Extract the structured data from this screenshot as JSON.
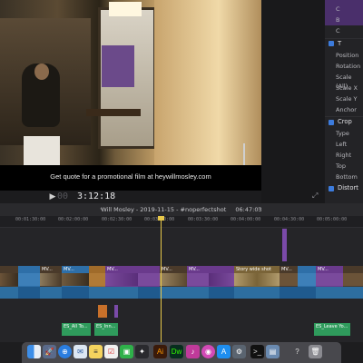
{
  "viewer": {
    "caption": "Get quote for a promotional film at heywillmosley.com",
    "timecode_dim": "00",
    "timecode": "3:12:18"
  },
  "inspector": {
    "rows_top": [
      "C",
      "B",
      "C"
    ],
    "transform_header": "T",
    "transform_rows": [
      "Position",
      "Rotation",
      "Scale (All)",
      "Scale X",
      "Scale Y",
      "Anchor"
    ],
    "crop_header": "Crop",
    "crop_rows": [
      "Type",
      "Left",
      "Right",
      "Top",
      "Bottom"
    ],
    "distort_header": "Distort"
  },
  "timeline": {
    "title": "Will Mosley - 2019-11-15 - #noperfectshot",
    "duration": "06:47:03",
    "ruler": [
      "00:01:30:00",
      "00:02:00:00",
      "00:02:30:00",
      "00:03:00:00",
      "00:03:30:00",
      "00:04:00:00",
      "00:04:30:00",
      "00:05:00:00"
    ],
    "clip_labels": [
      "MV...",
      "MV...",
      "MV...",
      "MV...",
      "MV...",
      "MV...",
      "Story wide shot",
      "MV..."
    ],
    "audio_labels": [
      "ES_All To...",
      "ES_Inn...",
      "ES_Leave Yo..."
    ]
  },
  "dock": {
    "icons": [
      "finder-icon",
      "launchpad-icon",
      "safari-icon",
      "mail-icon",
      "notes-icon",
      "reminders-icon",
      "facetime-icon",
      "final-cut-icon",
      "illustrator-icon",
      "dreamweaver-icon",
      "photoshop-icon",
      "itunes-icon",
      "podcasts-icon",
      "app-store-icon",
      "system-prefs-icon",
      "terminal-icon",
      "preview-icon",
      "help-icon",
      "trash-icon"
    ],
    "ai_label": "Ai",
    "dw_label": "Dw"
  }
}
